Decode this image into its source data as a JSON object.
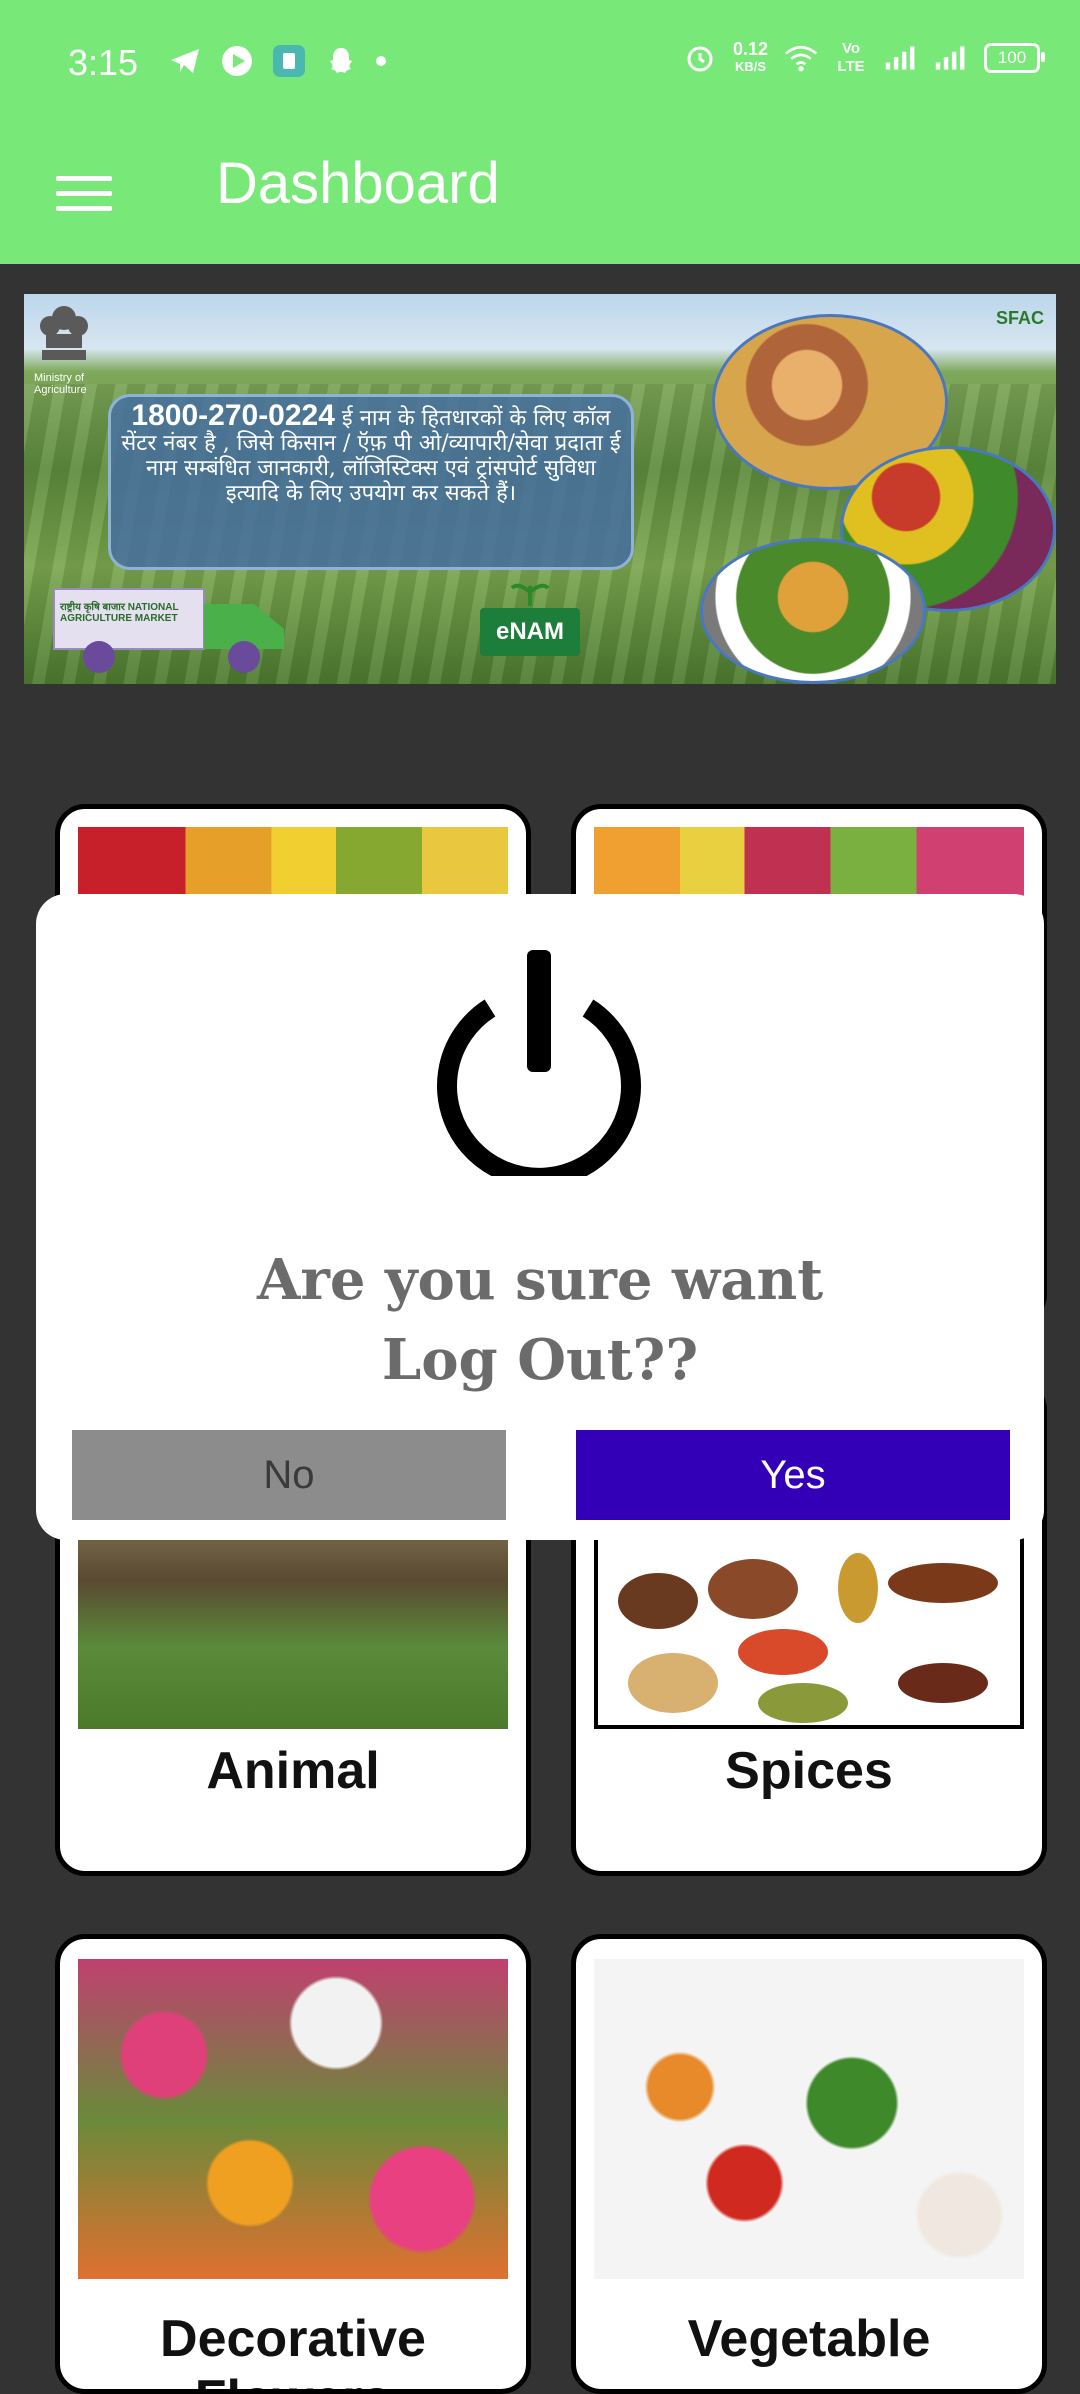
{
  "status_bar": {
    "time": "3:15",
    "network_speed_value": "0.12",
    "network_speed_unit": "KB/S",
    "volte": "Vo LTE",
    "battery": "100"
  },
  "app_bar": {
    "title": "Dashboard"
  },
  "banner": {
    "emblem_caption": "Ministry of Agriculture",
    "phone": "1800-270-0224",
    "message": "ई नाम के हितधारकों के लिए कॉल सेंटर नंबर है , जिसे किसान / ऍफ़ पी ओ/व्यापारी/सेवा प्रदाता ई नाम सम्बंधित जानकारी, लॉजिस्टिक्स  एवं ट्रांसपोर्ट सुविधा इत्यादि के लिए उपयोग कर सकते हैं।",
    "truck_label": "राष्ट्रीय कृषि बाजार NATIONAL AGRICULTURE MARKET",
    "enam_label": "eNAM",
    "sfac_label": "SFAC"
  },
  "categories": [
    {
      "label": ""
    },
    {
      "label": ""
    },
    {
      "label": "Animal"
    },
    {
      "label": "Spices"
    },
    {
      "label": "Decorative Flowers"
    },
    {
      "label": "Vegetable"
    }
  ],
  "dialog": {
    "message_line1": "Are you sure want",
    "message_line2": "Log Out??",
    "no_label": "No",
    "yes_label": "Yes"
  },
  "colors": {
    "app_bar": "#78e878",
    "background": "#333333",
    "yes_button": "#3300b8",
    "no_button": "#8c8c8c"
  }
}
